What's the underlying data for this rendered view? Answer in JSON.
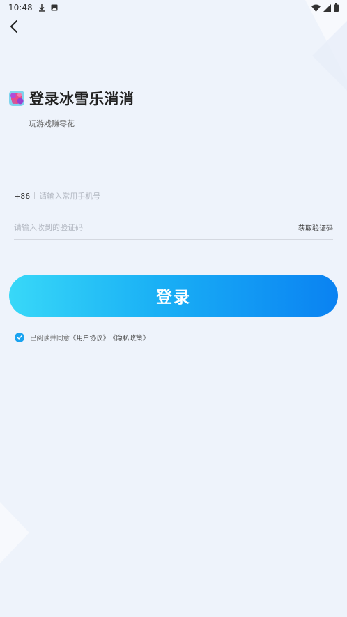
{
  "status_bar": {
    "time": "10:48"
  },
  "header": {
    "title": "登录冰雪乐消消",
    "subtitle": "玩游戏赚零花"
  },
  "phone": {
    "prefix": "+86",
    "placeholder": "请输入常用手机号"
  },
  "code": {
    "placeholder": "请输入收到的验证码",
    "get_code_label": "获取验证码"
  },
  "login_button": {
    "label": "登录"
  },
  "agreement": {
    "prefix": "已阅读并同意",
    "user_agreement": "《用户协议》",
    "privacy_policy": "《隐私政策》",
    "checked": true
  },
  "colors": {
    "accent": "#0a82f2",
    "gradient_start": "#38d8f8",
    "background": "#eef3fb"
  }
}
